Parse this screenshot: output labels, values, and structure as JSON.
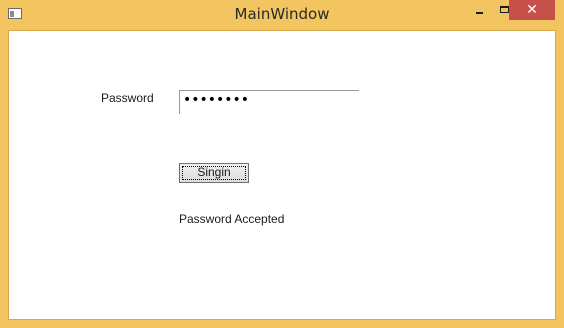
{
  "window": {
    "title": "MainWindow",
    "controls": {
      "minimize": "minimize",
      "maximize": "maximize",
      "close": "close"
    }
  },
  "form": {
    "password_label": "Password",
    "password_value_masked": "••••••••",
    "signin_label": "Singin",
    "status": "Password Accepted"
  },
  "colors": {
    "frame": "#f2c560",
    "close_button": "#c7514a",
    "client_background": "#ffffff"
  }
}
